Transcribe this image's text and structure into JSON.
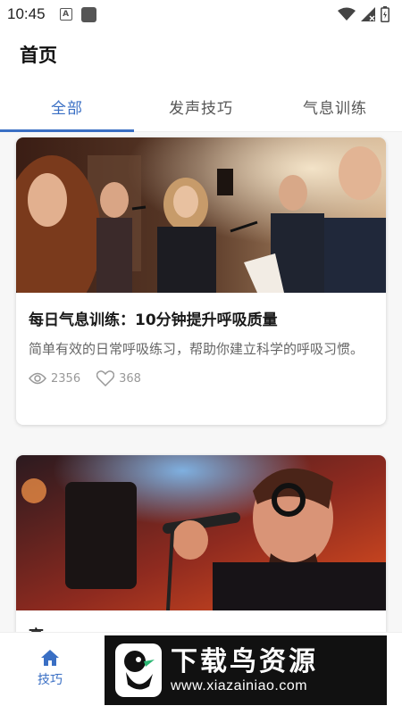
{
  "status_bar": {
    "time": "10:45",
    "icons": [
      "a-icon",
      "square-icon",
      "wifi-icon",
      "signal-icon",
      "battery-icon"
    ]
  },
  "header": {
    "title": "首页"
  },
  "tabs": [
    {
      "label": "全部",
      "active": true
    },
    {
      "label": "发声技巧",
      "active": false
    },
    {
      "label": "气息训练",
      "active": false
    }
  ],
  "cards": [
    {
      "image": "choir-singers-photo",
      "title": "每日气息训练：10分钟提升呼吸质量",
      "description": "简单有效的日常呼吸练习，帮助你建立科学的呼吸习惯。",
      "views": "2356",
      "likes": "368"
    },
    {
      "image": "male-singer-microphone-photo",
      "title": "高..."
    }
  ],
  "bottom_nav": {
    "items": [
      {
        "label": "技巧",
        "icon": "home-icon",
        "active": true
      }
    ]
  },
  "watermark": {
    "title": "下载鸟资源",
    "url": "www.xiazainiao.com"
  },
  "colors": {
    "accent": "#3a6fc4",
    "text": "#1a1a1a",
    "muted": "#999999"
  }
}
